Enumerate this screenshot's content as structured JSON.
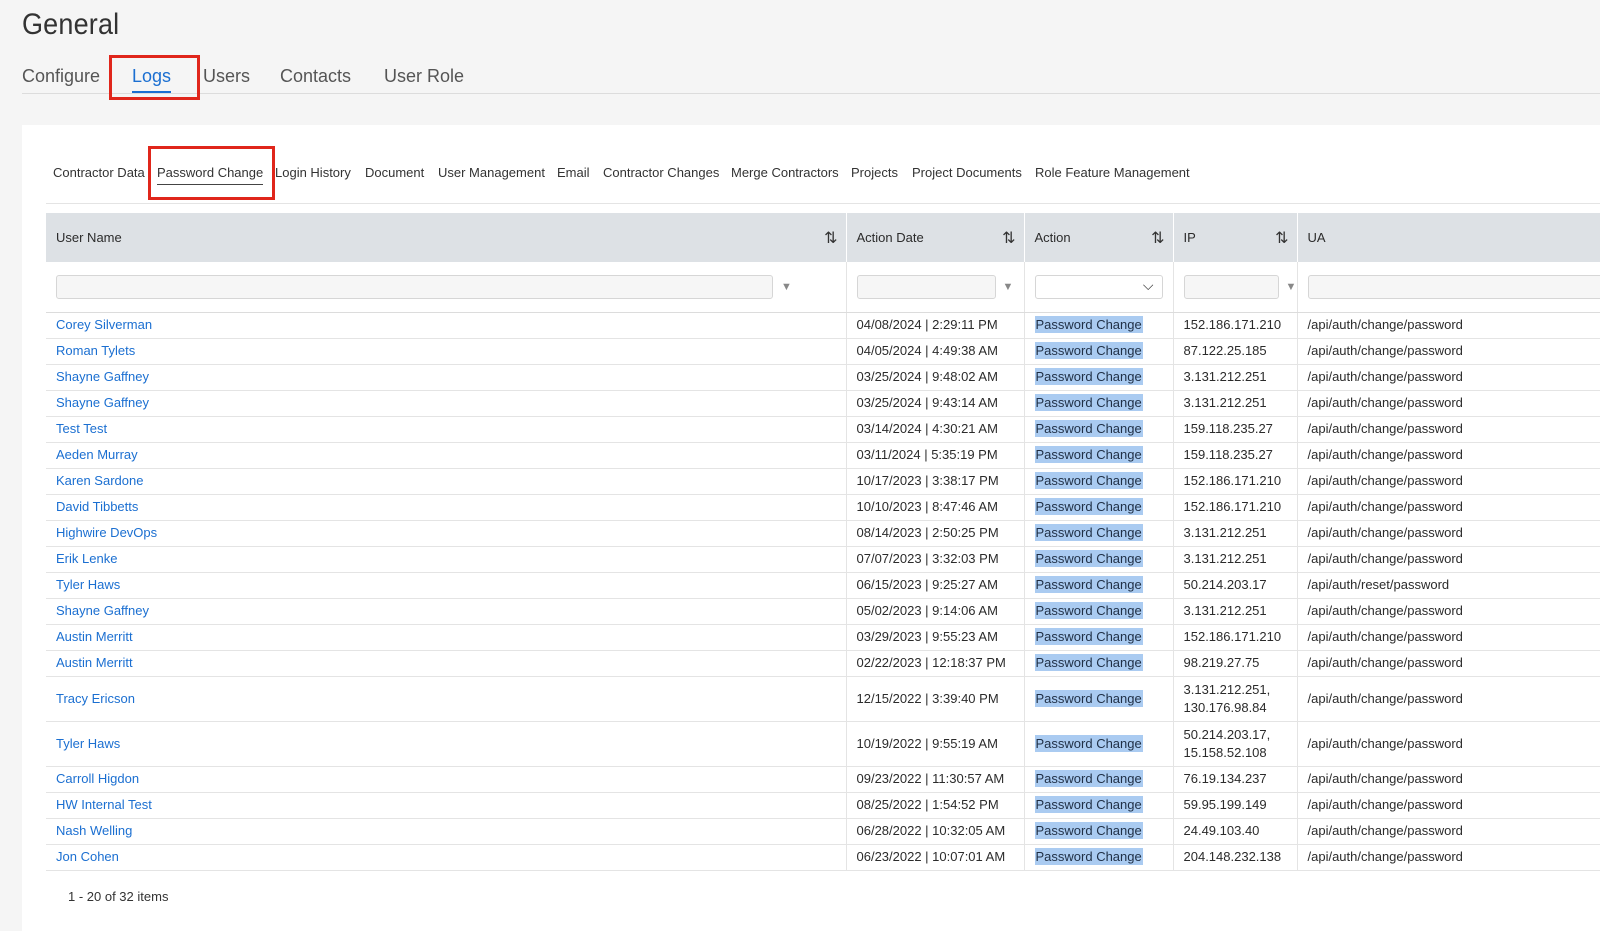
{
  "page_title": "General",
  "main_tabs": [
    "Configure",
    "Logs",
    "Users",
    "Contacts",
    "User Role"
  ],
  "sub_tabs": [
    "Contractor Data",
    "Password Change",
    "Login History",
    "Document",
    "User Management",
    "Email",
    "Contractor Changes",
    "Merge Contractors",
    "Projects",
    "Project Documents",
    "Role Feature Management"
  ],
  "columns": [
    "User Name",
    "Action Date",
    "Action",
    "IP",
    "UA"
  ],
  "rows": [
    {
      "user": "Corey Silverman",
      "date": "04/08/2024 | 2:29:11 PM",
      "action": "Password Change",
      "ip": "152.186.171.210",
      "ua": "/api/auth/change/password"
    },
    {
      "user": "Roman Tylets",
      "date": "04/05/2024 | 4:49:38 AM",
      "action": "Password Change",
      "ip": "87.122.25.185",
      "ua": "/api/auth/change/password"
    },
    {
      "user": "Shayne Gaffney",
      "date": "03/25/2024 | 9:48:02 AM",
      "action": "Password Change",
      "ip": "3.131.212.251",
      "ua": "/api/auth/change/password"
    },
    {
      "user": "Shayne Gaffney",
      "date": "03/25/2024 | 9:43:14 AM",
      "action": "Password Change",
      "ip": "3.131.212.251",
      "ua": "/api/auth/change/password"
    },
    {
      "user": "Test Test",
      "date": "03/14/2024 | 4:30:21 AM",
      "action": "Password Change",
      "ip": "159.118.235.27",
      "ua": "/api/auth/change/password"
    },
    {
      "user": "Aeden Murray",
      "date": "03/11/2024 | 5:35:19 PM",
      "action": "Password Change",
      "ip": "159.118.235.27",
      "ua": "/api/auth/change/password"
    },
    {
      "user": "Karen Sardone",
      "date": "10/17/2023 | 3:38:17 PM",
      "action": "Password Change",
      "ip": "152.186.171.210",
      "ua": "/api/auth/change/password"
    },
    {
      "user": "David Tibbetts",
      "date": "10/10/2023 | 8:47:46 AM",
      "action": "Password Change",
      "ip": "152.186.171.210",
      "ua": "/api/auth/change/password"
    },
    {
      "user": "Highwire DevOps",
      "date": "08/14/2023 | 2:50:25 PM",
      "action": "Password Change",
      "ip": "3.131.212.251",
      "ua": "/api/auth/change/password"
    },
    {
      "user": "Erik Lenke",
      "date": "07/07/2023 | 3:32:03 PM",
      "action": "Password Change",
      "ip": "3.131.212.251",
      "ua": "/api/auth/change/password"
    },
    {
      "user": "Tyler Haws",
      "date": "06/15/2023 | 9:25:27 AM",
      "action": "Password Change",
      "ip": "50.214.203.17",
      "ua": "/api/auth/reset/password"
    },
    {
      "user": "Shayne Gaffney",
      "date": "05/02/2023 | 9:14:06 AM",
      "action": "Password Change",
      "ip": "3.131.212.251",
      "ua": "/api/auth/change/password"
    },
    {
      "user": "Austin Merritt",
      "date": "03/29/2023 | 9:55:23 AM",
      "action": "Password Change",
      "ip": "152.186.171.210",
      "ua": "/api/auth/change/password"
    },
    {
      "user": "Austin Merritt",
      "date": "02/22/2023 | 12:18:37 PM",
      "action": "Password Change",
      "ip": "98.219.27.75",
      "ua": "/api/auth/change/password"
    },
    {
      "user": "Tracy Ericson",
      "date": "12/15/2022 | 3:39:40 PM",
      "action": "Password Change",
      "ip": "3.131.212.251, 130.176.98.84",
      "ua": "/api/auth/change/password",
      "tall": true
    },
    {
      "user": "Tyler Haws",
      "date": "10/19/2022 | 9:55:19 AM",
      "action": "Password Change",
      "ip": "50.214.203.17, 15.158.52.108",
      "ua": "/api/auth/change/password",
      "tall": true
    },
    {
      "user": "Carroll Higdon",
      "date": "09/23/2022 | 11:30:57 AM",
      "action": "Password Change",
      "ip": "76.19.134.237",
      "ua": "/api/auth/change/password"
    },
    {
      "user": "HW Internal Test",
      "date": "08/25/2022 | 1:54:52 PM",
      "action": "Password Change",
      "ip": "59.95.199.149",
      "ua": "/api/auth/change/password"
    },
    {
      "user": "Nash Welling",
      "date": "06/28/2022 | 10:32:05 AM",
      "action": "Password Change",
      "ip": "24.49.103.40",
      "ua": "/api/auth/change/password"
    },
    {
      "user": "Jon Cohen",
      "date": "06/23/2022 | 10:07:01 AM",
      "action": "Password Change",
      "ip": "204.148.232.138",
      "ua": "/api/auth/change/password"
    }
  ],
  "pager_text": "1 - 20 of 32 items",
  "colors": {
    "accent": "#1b6fd1",
    "highlight_box": "#e0261b",
    "action_tag": "#aacbf1",
    "header_bg": "#dde1e5"
  }
}
